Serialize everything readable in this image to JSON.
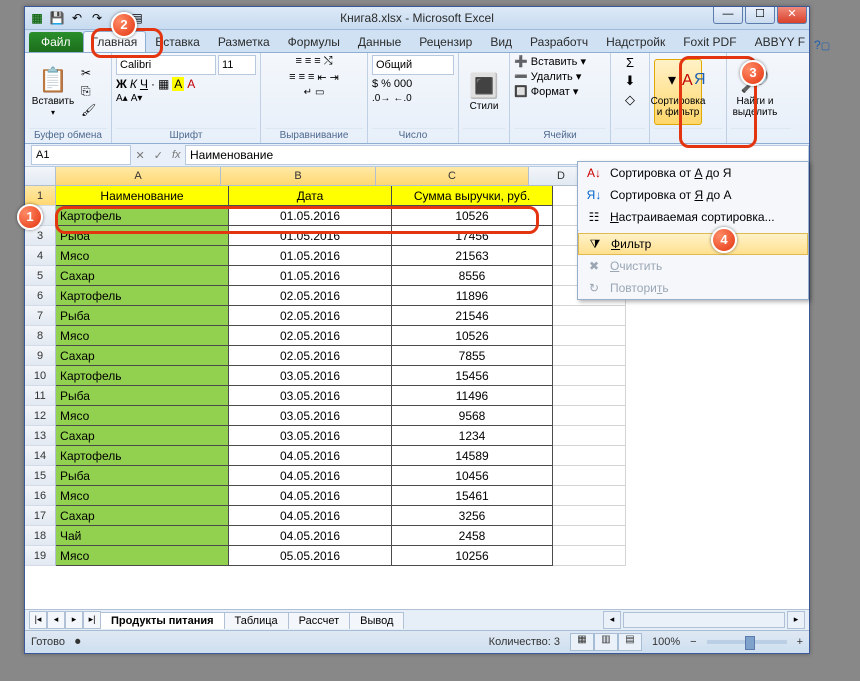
{
  "window": {
    "title": "Книга8.xlsx - Microsoft Excel"
  },
  "tabs": {
    "file": "Файл",
    "list": [
      "Главная",
      "Вставка",
      "Разметка",
      "Формулы",
      "Данные",
      "Рецензир",
      "Вид",
      "Разработч",
      "Надстройк",
      "Foxit PDF",
      "ABBYY F"
    ],
    "active_index": 0
  },
  "ribbon": {
    "groups": {
      "clipboard": {
        "label": "Буфер обмена",
        "paste": "Вставить"
      },
      "font": {
        "label": "Шрифт",
        "name": "Calibri",
        "size": "11"
      },
      "alignment": {
        "label": "Выравнивание"
      },
      "number": {
        "label": "Число",
        "format": "Общий"
      },
      "styles": {
        "label": "",
        "styles_btn": "Стили"
      },
      "cells": {
        "label": "Ячейки",
        "insert": "Вставить",
        "delete": "Удалить",
        "format": "Формат"
      },
      "editing": {
        "label": "",
        "sort_filter": "Сортировка и фильтр",
        "find_select": "Найти и выделить"
      }
    }
  },
  "namebox": "A1",
  "formula": "Наименование",
  "columns": [
    "A",
    "B",
    "C",
    "D"
  ],
  "table": {
    "headers": [
      "Наименование",
      "Дата",
      "Сумма выручки, руб."
    ],
    "rows": [
      {
        "n": "Картофель",
        "d": "01.05.2016",
        "s": "10526"
      },
      {
        "n": "Рыба",
        "d": "01.05.2016",
        "s": "17456"
      },
      {
        "n": "Мясо",
        "d": "01.05.2016",
        "s": "21563"
      },
      {
        "n": "Сахар",
        "d": "01.05.2016",
        "s": "8556"
      },
      {
        "n": "Картофель",
        "d": "02.05.2016",
        "s": "11896"
      },
      {
        "n": "Рыба",
        "d": "02.05.2016",
        "s": "21546"
      },
      {
        "n": "Мясо",
        "d": "02.05.2016",
        "s": "10526"
      },
      {
        "n": "Сахар",
        "d": "02.05.2016",
        "s": "7855"
      },
      {
        "n": "Картофель",
        "d": "03.05.2016",
        "s": "15456"
      },
      {
        "n": "Рыба",
        "d": "03.05.2016",
        "s": "11496"
      },
      {
        "n": "Мясо",
        "d": "03.05.2016",
        "s": "9568"
      },
      {
        "n": "Сахар",
        "d": "03.05.2016",
        "s": "1234"
      },
      {
        "n": "Картофель",
        "d": "04.05.2016",
        "s": "14589"
      },
      {
        "n": "Рыба",
        "d": "04.05.2016",
        "s": "10456"
      },
      {
        "n": "Мясо",
        "d": "04.05.2016",
        "s": "15461"
      },
      {
        "n": "Сахар",
        "d": "04.05.2016",
        "s": "3256"
      },
      {
        "n": "Чай",
        "d": "04.05.2016",
        "s": "2458"
      },
      {
        "n": "Мясо",
        "d": "05.05.2016",
        "s": "10256"
      }
    ]
  },
  "sheets": {
    "tabs": [
      "Продукты питания",
      "Таблица",
      "Рассчет",
      "Вывод"
    ],
    "active_index": 0
  },
  "status": {
    "ready": "Готово",
    "count_label": "Количество: 3",
    "zoom": "100%"
  },
  "dropdown": {
    "sort_az": "Сортировка от А до Я",
    "sort_za": "Сортировка от Я до А",
    "custom_sort": "Настраиваемая сортировка...",
    "filter": "Фильтр",
    "clear": "Очистить",
    "reapply": "Повторить"
  },
  "badges": {
    "b1": "1",
    "b2": "2",
    "b3": "3",
    "b4": "4"
  }
}
